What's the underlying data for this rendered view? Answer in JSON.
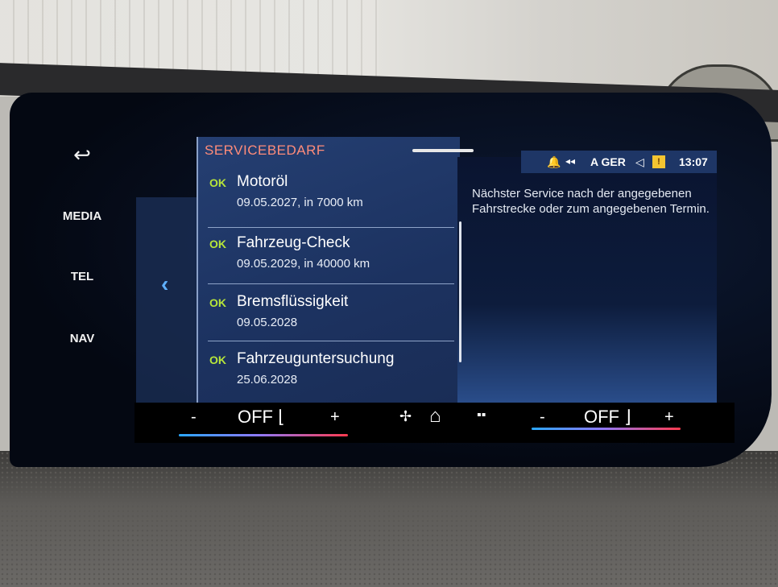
{
  "sidebar": {
    "back_icon": "↩",
    "media": "MEDIA",
    "tel": "TEL",
    "nav": "NAV"
  },
  "nav": {
    "prev_icon": "‹"
  },
  "service": {
    "title": "SERVICEBEDARF",
    "items": [
      {
        "status": "OK",
        "name": "Motoröl",
        "due": "09.05.2027, in 7000 km"
      },
      {
        "status": "OK",
        "name": "Fahrzeug-Check",
        "due": "09.05.2029, in 40000 km"
      },
      {
        "status": "OK",
        "name": "Bremsflüssigkeit",
        "due": "09.05.2028"
      },
      {
        "status": "OK",
        "name": "Fahrzeuguntersuchung",
        "due": "25.06.2028"
      }
    ]
  },
  "status_bar": {
    "bell_icon": "🔔",
    "signal_icon": "◂◂",
    "language": "A GER",
    "speaker_icon": "◁",
    "warning_icon": "!",
    "time": "13:07"
  },
  "info": {
    "text": "Nächster Service nach der angegebenen Fahrstrecke oder zum angegebenen Termin."
  },
  "climate": {
    "left_minus": "-",
    "left_value": "OFF ⌊",
    "left_plus": "+",
    "fan_icon": "✢",
    "home_icon": "⌂",
    "apps_icon": "▪▪",
    "right_minus": "-",
    "right_value": "OFF ⌋",
    "right_plus": "+"
  }
}
